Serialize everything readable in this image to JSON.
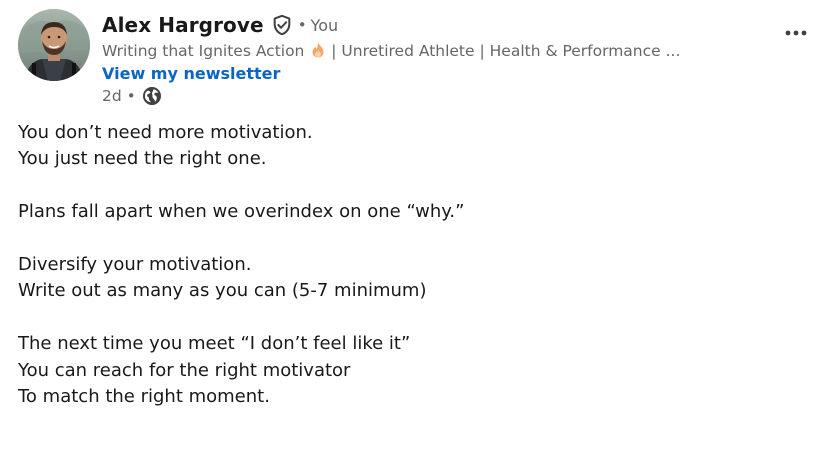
{
  "author": {
    "name": "Alex Hargrove",
    "connection": "You",
    "dot": "•",
    "headline_before_emoji": "Writing that Ignites Action",
    "headline_emoji_icon": "fire-emoji-icon",
    "headline_after_emoji": " | Unretired Athlete | Health & Performance ...",
    "newsletter_link": "View my newsletter",
    "timestamp": "2d",
    "visibility_icon": "globe-icon"
  },
  "menu": {
    "icon": "more-options-icon",
    "glyph": "•••"
  },
  "colors": {
    "link": "#0a66c2",
    "secondary_text": "#666666",
    "primary_text": "#191919"
  },
  "post": {
    "paragraphs": [
      [
        "You don’t need more motivation.",
        "You just need the right one."
      ],
      [
        "Plans fall apart when we overindex on one “why.”"
      ],
      [
        "Diversify your motivation.",
        "Write out as many as you can (5-7 minimum)"
      ],
      [
        "The next time you meet “I don’t feel like it”",
        "You can reach for the right motivator",
        "To match the right moment."
      ]
    ]
  }
}
